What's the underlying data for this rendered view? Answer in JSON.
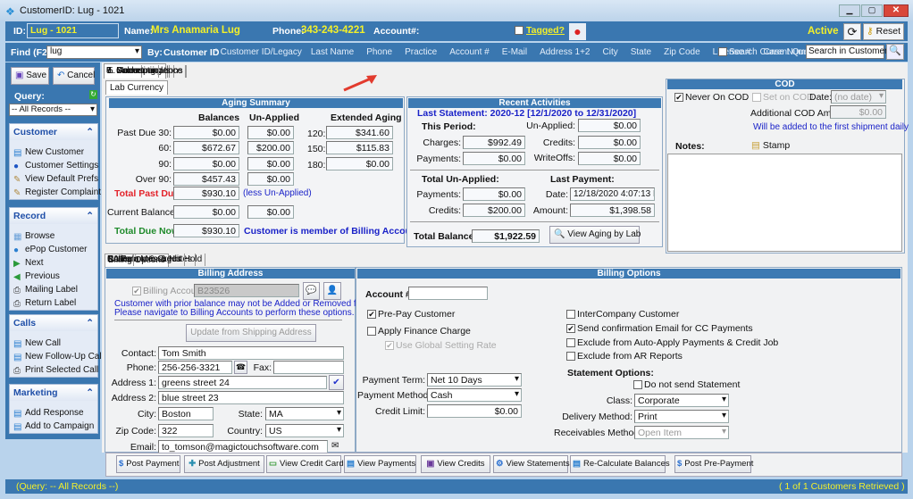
{
  "window": {
    "title": "CustomerID: Lug - 1021"
  },
  "header": {
    "id_label": "ID:",
    "id_value": "Lug - 1021",
    "name_label": "Name:",
    "name_value": "Mrs Anamaria Lug",
    "phone_label": "Phone:",
    "phone_value": "343-243-4221",
    "account_label": "Account#:",
    "tagged_label": "Tagged?",
    "tagged": false,
    "status": "Active",
    "reset_label": "Reset"
  },
  "find": {
    "label": "Find (F2)",
    "value": "lug",
    "by_label": "By:",
    "by_value": "Customer ID",
    "options": [
      "* Customer ID/Legacy",
      "Last Name",
      "Phone",
      "Practice",
      "Account #",
      "E-Mail",
      "Address 1+2",
      "City",
      "State",
      "Zip Code",
      "License #",
      "Case Numb"
    ],
    "search_current_query": "Search Current Query",
    "search_value": "Search in Customer"
  },
  "sidebar": {
    "save": "Save",
    "cancel": "Cancel",
    "query_label": "Query:",
    "query_value": "-- All Records --",
    "groups": [
      {
        "title": "Customer",
        "items": [
          "New Customer",
          "Customer Settings",
          "View Default Prefs",
          "Register Complaint"
        ]
      },
      {
        "title": "Record",
        "items": [
          "Browse",
          "ePop Customer",
          "Next",
          "Previous",
          "Mailing Label",
          "Return Label"
        ]
      },
      {
        "title": "Calls",
        "items": [
          "New Call",
          "New Follow-Up Call",
          "Print Selected Call"
        ]
      },
      {
        "title": "Marketing",
        "items": [
          "Add Response",
          "Add to Campaign"
        ]
      }
    ]
  },
  "tabs": [
    "0. Customer",
    "1. Practice Info",
    "2. Related Info",
    "3. Calls & Notes",
    "4. Cases",
    "5. Accounting",
    "6. Sales",
    "7. Communications",
    "8. Correspondence",
    "9. Marketing"
  ],
  "active_tab": "5. Accounting",
  "subtab": "Lab Currency",
  "aging": {
    "title": "Aging Summary",
    "col_balances": "Balances",
    "col_unapplied": "Un-Applied",
    "col_extended": "Extended Aging",
    "rows": [
      {
        "label": "Past Due 30:",
        "bal": "$0.00",
        "un": "$0.00"
      },
      {
        "label": "60:",
        "bal": "$672.67",
        "un": "$200.00"
      },
      {
        "label": "90:",
        "bal": "$0.00",
        "un": "$0.00"
      },
      {
        "label": "Over 90:",
        "bal": "$457.43",
        "un": "$0.00"
      }
    ],
    "extended": [
      {
        "label": "120:",
        "value": "$341.60"
      },
      {
        "label": "150:",
        "value": "$115.83"
      },
      {
        "label": "180:",
        "value": "$0.00"
      }
    ],
    "total_past_due_label": "Total Past Due:",
    "total_past_due": "$930.10",
    "less_unapplied": "(less Un-Applied)",
    "current_balance_label": "Current Balance:",
    "current_balance": "$0.00",
    "current_unapplied": "$0.00",
    "total_due_label": "Total Due Now:",
    "total_due": "$930.10",
    "member_note": "Customer is member of Billing Account."
  },
  "recent": {
    "title": "Recent Activities",
    "last_statement": "Last Statement: 2020-12   [12/1/2020 to 12/31/2020]",
    "this_period": "This Period:",
    "unapplied_label": "Un-Applied:",
    "unapplied": "$0.00",
    "charges_label": "Charges:",
    "charges": "$992.49",
    "credits_label": "Credits:",
    "credits": "$0.00",
    "payments_label": "Payments:",
    "payments": "$0.00",
    "writeoffs_label": "WriteOffs:",
    "writeoffs": "$0.00",
    "total_unapplied": "Total Un-Applied:",
    "tu_payments_label": "Payments:",
    "tu_payments": "$0.00",
    "tu_credits_label": "Credits:",
    "tu_credits": "$200.00",
    "last_payment": "Last Payment:",
    "date_label": "Date:",
    "date": "12/18/2020 4:07:13 PM",
    "amount_label": "Amount:",
    "amount": "$1,398.58",
    "total_balance_label": "Total Balance:",
    "total_balance": "$1,922.59",
    "view_aging": "View Aging by Lab"
  },
  "cod": {
    "title": "COD",
    "never_on_cod": "Never On COD",
    "never_checked": true,
    "set_on_cod": "Set on COD",
    "date_label": "Date:",
    "date_value": "(no date)",
    "additional_label": "Additional COD Amount:",
    "additional_value": "$0.00",
    "note": "Will be added to the first shipment daily",
    "notes_label": "Notes:",
    "stamp": "Stamp"
  },
  "lower_tabs": [
    "Billing Options",
    "BA Balances & Notes",
    "Collection & Credit Hold",
    "Custom Messages",
    "Notes"
  ],
  "billing_address": {
    "title": "Billing Address",
    "billing_account_label": "Billing Account:",
    "billing_account": "B23526",
    "warning1": "Customer with prior balance may not be Added or Removed from here.",
    "warning2": "Please navigate to Billing Accounts to perform these options.",
    "update_btn": "Update from Shipping Address",
    "contact_label": "Contact:",
    "contact": "Tom Smith",
    "phone_label": "Phone:",
    "phone": "256-256-3321",
    "fax_label": "Fax:",
    "fax": "",
    "address1_label": "Address 1:",
    "address1": "greens street 24",
    "address2_label": "Address 2:",
    "address2": "blue street 23",
    "city_label": "City:",
    "city": "Boston",
    "state_label": "State:",
    "state": "MA",
    "zip_label": "Zip Code:",
    "zip": "322",
    "country_label": "Country:",
    "country": "US",
    "email_label": "Email:",
    "email": "to_tomson@magictouchsoftware.com"
  },
  "billing_options": {
    "title": "Billing Options",
    "account_label": "Account #:",
    "account": "",
    "prepay": "Pre-Pay Customer",
    "apply_finance": "Apply Finance Charge",
    "use_global": "Use Global Setting Rate",
    "payment_term_label": "Payment Term:",
    "payment_term": "Net 10 Days",
    "payment_method_label": "Payment Method:",
    "payment_method": "Cash",
    "credit_limit_label": "Credit Limit:",
    "credit_limit": "$0.00",
    "intercompany": "InterCompany Customer",
    "send_conf": "Send confirmation Email for CC Payments",
    "exclude_auto": "Exclude from Auto-Apply Payments & Credit Job",
    "exclude_ar": "Exclude from AR Reports",
    "statement_options": "Statement Options:",
    "do_not_send": "Do not send Statement",
    "class_label": "Class:",
    "class": "Corporate",
    "delivery_label": "Delivery Method:",
    "delivery": "Print",
    "receivables_label": "Receivables Method:",
    "receivables": "Open Item"
  },
  "actions": [
    "Post Payment",
    "Post Adjustment",
    "View Credit Cards",
    "View Payments",
    "View Credits",
    "View Statements",
    "Re-Calculate Balances",
    "Post Pre-Payment"
  ],
  "status": {
    "left": "(Query: -- All Records --)",
    "right": "( 1 of 1 Customers Retrieved )"
  }
}
